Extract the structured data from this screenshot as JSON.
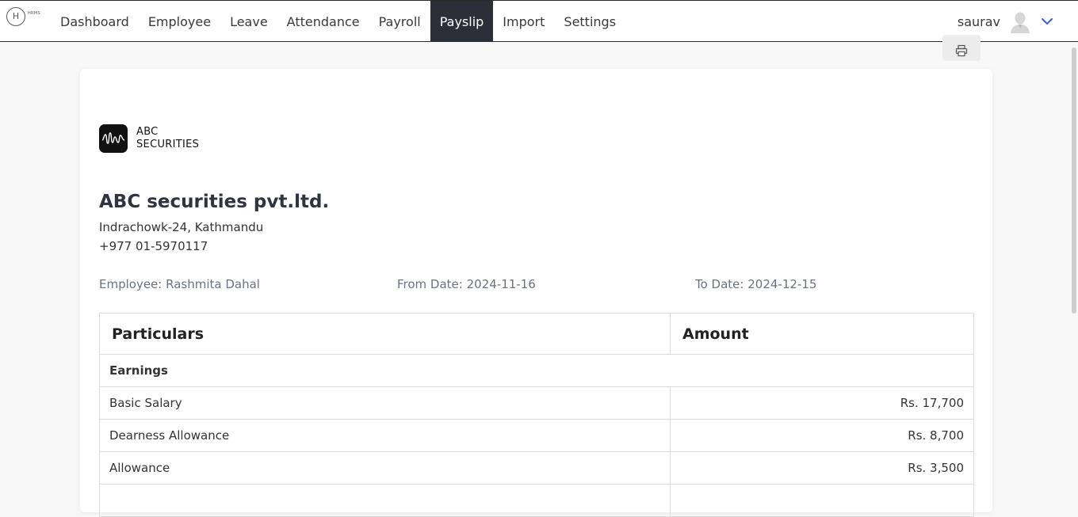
{
  "nav": {
    "logo_letter": "H",
    "logo_sub": "HRMS",
    "items": [
      {
        "label": "Dashboard"
      },
      {
        "label": "Employee"
      },
      {
        "label": "Leave"
      },
      {
        "label": "Attendance"
      },
      {
        "label": "Payroll"
      },
      {
        "label": "Payslip",
        "active": true
      },
      {
        "label": "Import"
      },
      {
        "label": "Settings"
      }
    ],
    "user": "saurav",
    "accent_color": "#3b5bdb",
    "active_bg": "#2b3038"
  },
  "payslip": {
    "brand_line1": "ABC",
    "brand_line2": "SECURITIES",
    "company_name": "ABC securities pvt.ltd.",
    "address": "Indrachowk-24, Kathmandu",
    "phone": "+977 01-5970117",
    "employee": "Employee: Rashmita Dahal",
    "from_date": "From Date: 2024-11-16",
    "to_date": "To Date: 2024-12-15",
    "table": {
      "headers": [
        "Particulars",
        "Amount"
      ],
      "section": "Earnings",
      "rows": [
        {
          "label": "Basic Salary",
          "amount": "Rs. 17,700"
        },
        {
          "label": "Dearness Allowance",
          "amount": "Rs. 8,700"
        },
        {
          "label": "Allowance",
          "amount": "Rs. 3,500"
        }
      ]
    }
  }
}
